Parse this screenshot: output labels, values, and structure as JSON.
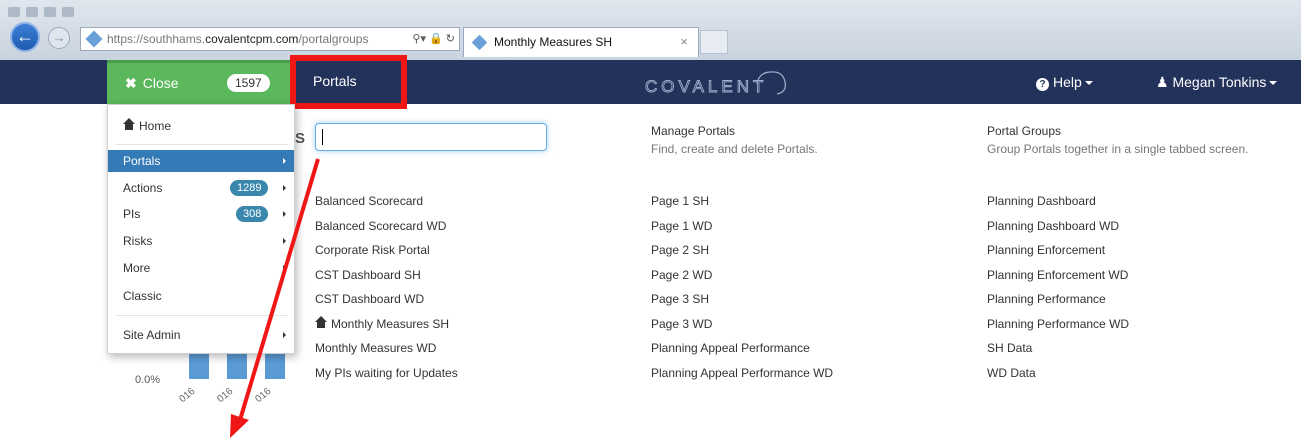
{
  "browser": {
    "url_prefix": "https://southhams.",
    "url_domain": "covalentcpm.com",
    "url_suffix": "/portalgroups",
    "tab_title": "Monthly Measures SH",
    "tab_close": "×"
  },
  "navbar": {
    "close_label": "Close",
    "close_count": "1597",
    "portals_label": "Portals",
    "logo_text": "COVALENT",
    "help_label": "Help",
    "user_name": "Megan Tonkins",
    "highlight_color": "#ef1616"
  },
  "menu": {
    "items": [
      {
        "label": "Home"
      },
      {
        "label": "Portals"
      },
      {
        "label": "Actions",
        "badge": "1289"
      },
      {
        "label": "PIs",
        "badge": "308"
      },
      {
        "label": "Risks"
      },
      {
        "label": "More"
      },
      {
        "label": "Classic"
      },
      {
        "label": "Site Admin"
      }
    ]
  },
  "background": {
    "axis_value": "0.0%",
    "ticks": [
      "016",
      "016",
      "016"
    ],
    "partial_letter": "S"
  },
  "search": {
    "value": ""
  },
  "headers": [
    {
      "title": "Manage Portals",
      "desc": "Find, create and delete Portals."
    },
    {
      "title": "Portal Groups",
      "desc": "Group Portals together in a single tabbed screen."
    }
  ],
  "portals": {
    "col1": [
      "Balanced Scorecard",
      "Balanced Scorecard WD",
      "Corporate Risk Portal",
      "CST Dashboard SH",
      "CST Dashboard WD",
      "Monthly Measures SH",
      "Monthly Measures WD",
      "My PIs waiting for Updates"
    ],
    "col2": [
      "Page 1 SH",
      "Page 1 WD",
      "Page 2 SH",
      "Page 2 WD",
      "Page 3 SH",
      "Page 3 WD",
      "Planning Appeal Performance",
      "Planning Appeal Performance WD"
    ],
    "col3": [
      "Planning Dashboard",
      "Planning Dashboard WD",
      "Planning Enforcement",
      "Planning Enforcement WD",
      "Planning Performance",
      "Planning Performance WD",
      "SH Data",
      "WD Data"
    ]
  },
  "colors": {
    "navbar": "#22325a",
    "close_button": "#5cb85c",
    "active_menu": "#337ab7",
    "arrow": "#ef1616"
  }
}
